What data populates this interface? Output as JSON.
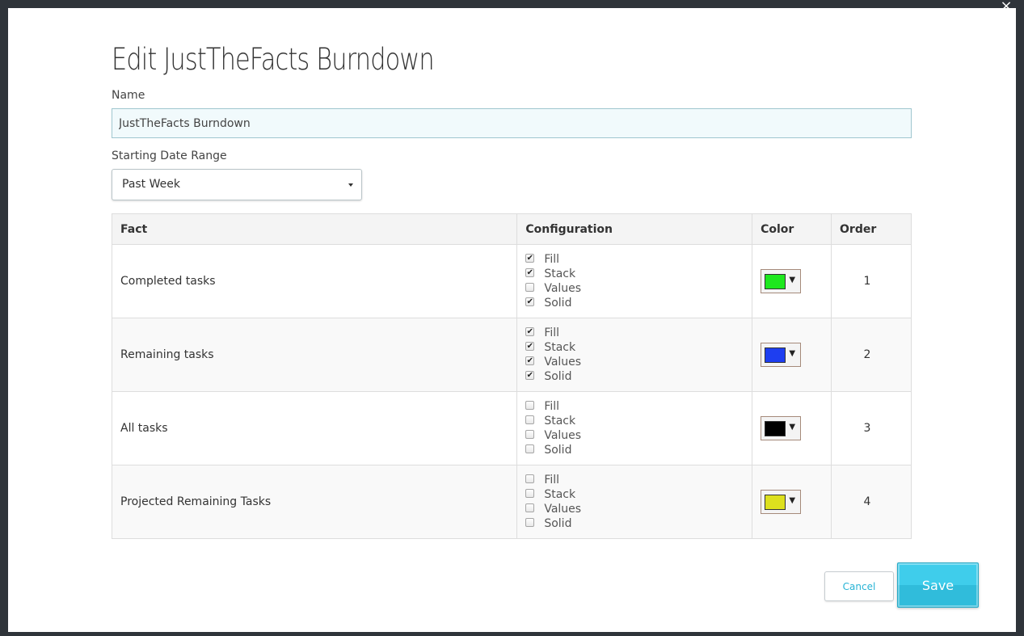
{
  "modal": {
    "title": "Edit JustTheFacts Burndown",
    "close_glyph": "×"
  },
  "form": {
    "name_label": "Name",
    "name_value": "JustTheFacts Burndown",
    "date_range_label": "Starting Date Range",
    "date_range_value": "Past Week"
  },
  "table": {
    "headers": {
      "fact": "Fact",
      "configuration": "Configuration",
      "color": "Color",
      "order": "Order"
    },
    "option_labels": {
      "fill": "Fill",
      "stack": "Stack",
      "values": "Values",
      "solid": "Solid"
    },
    "rows": [
      {
        "fact": "Completed tasks",
        "fill": true,
        "stack": true,
        "values": false,
        "solid": true,
        "color": "#1ee81e",
        "order": "1"
      },
      {
        "fact": "Remaining tasks",
        "fill": true,
        "stack": true,
        "values": true,
        "solid": true,
        "color": "#1e3ef0",
        "order": "2"
      },
      {
        "fact": "All tasks",
        "fill": false,
        "stack": false,
        "values": false,
        "solid": false,
        "color": "#000000",
        "order": "3"
      },
      {
        "fact": "Projected Remaining Tasks",
        "fill": false,
        "stack": false,
        "values": false,
        "solid": false,
        "color": "#dde01e",
        "order": "4"
      }
    ]
  },
  "buttons": {
    "cancel": "Cancel",
    "save": "Save"
  },
  "icons": {
    "close": "close-icon",
    "dropdown_caret": "caret-down-icon",
    "color_arrow": "triangle-down-icon",
    "checkmark": "checkmark-icon"
  }
}
